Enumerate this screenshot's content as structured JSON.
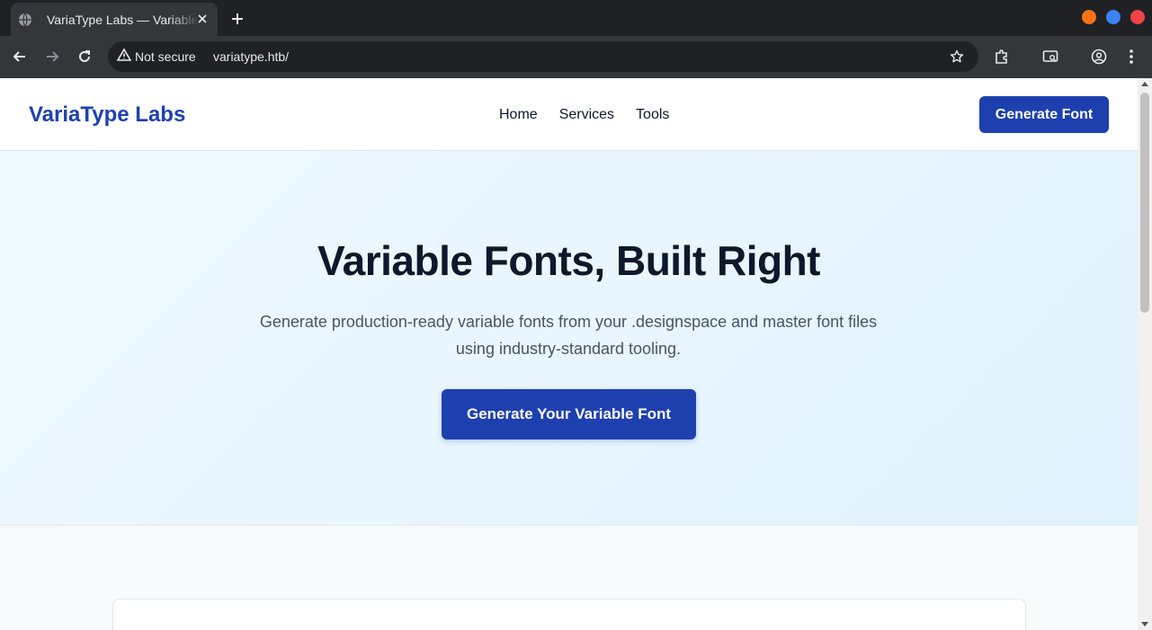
{
  "browser": {
    "tab_title": "VariaType Labs — Variable Font Generator",
    "security_label": "Not secure",
    "url": "variatype.htb/",
    "window_dot_colors": [
      "#f97316",
      "#3b82f6",
      "#ef4444"
    ]
  },
  "header": {
    "logo": "VariaType Labs",
    "nav": [
      {
        "label": "Home"
      },
      {
        "label": "Services"
      },
      {
        "label": "Tools"
      }
    ],
    "cta": "Generate Font"
  },
  "hero": {
    "title": "Variable Fonts, Built Right",
    "subtitle": "Generate production-ready variable fonts from your .designspace and master font files using industry-standard tooling.",
    "cta": "Generate Your Variable Font"
  },
  "theme": {
    "accent": "#1e40af",
    "text_dark": "#0f172a",
    "text_muted": "#475569"
  }
}
